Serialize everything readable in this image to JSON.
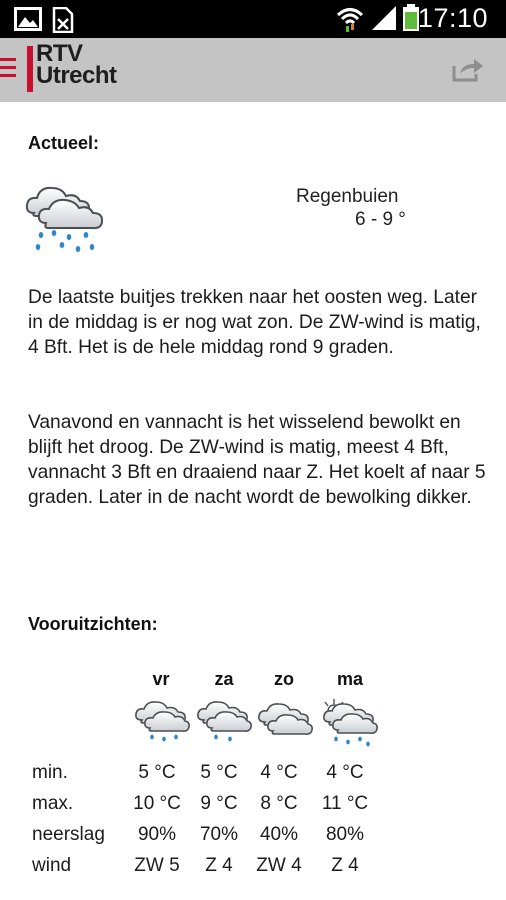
{
  "status_bar": {
    "time": "17:10",
    "icons": [
      "gallery-icon",
      "sim-missing-icon",
      "wifi-icon",
      "signal-icon",
      "battery-icon"
    ],
    "battery_color": "#5fba3d"
  },
  "app_bar": {
    "logo_line1": "RTV",
    "logo_line2": "Utrecht",
    "brand_color": "#c8102e",
    "actions": [
      "menu-icon",
      "share-icon"
    ]
  },
  "current": {
    "title": "Actueel:",
    "icon": "rain-showers-icon",
    "description": "Regenbuien",
    "temperature": "6 - 9 °",
    "paragraph1": "De laatste buitjes trekken naar het oosten weg. Later in de middag is er nog wat zon. De ZW-wind is matig, 4 Bft. Het is de hele middag rond 9 graden.",
    "paragraph2": "Vanavond en vannacht is het wisselend bewolkt en blijft het droog. De ZW-wind is matig, meest 4 Bft, vannacht 3 Bft en draaiend naar Z. Het koelt af naar 5 graden. Later in de nacht wordt de bewolking dikker."
  },
  "forecast": {
    "title": "Vooruitzichten:",
    "days": [
      {
        "label": "vr",
        "icon": "rain-icon",
        "min": "5 °C",
        "max": "10 °C",
        "neerslag": "90%",
        "wind": "ZW 5"
      },
      {
        "label": "za",
        "icon": "rain-icon",
        "min": "5 °C",
        "max": "9 °C",
        "neerslag": "70%",
        "wind": "Z 4"
      },
      {
        "label": "zo",
        "icon": "cloud-icon",
        "min": "4 °C",
        "max": "8 °C",
        "neerslag": "40%",
        "wind": "ZW 4"
      },
      {
        "label": "ma",
        "icon": "rain-sun-icon",
        "min": "4 °C",
        "max": "11 °C",
        "neerslag": "80%",
        "wind": "Z 4"
      }
    ],
    "row_labels": {
      "min": "min.",
      "max": "max.",
      "neerslag": "neerslag",
      "wind": "wind"
    }
  }
}
